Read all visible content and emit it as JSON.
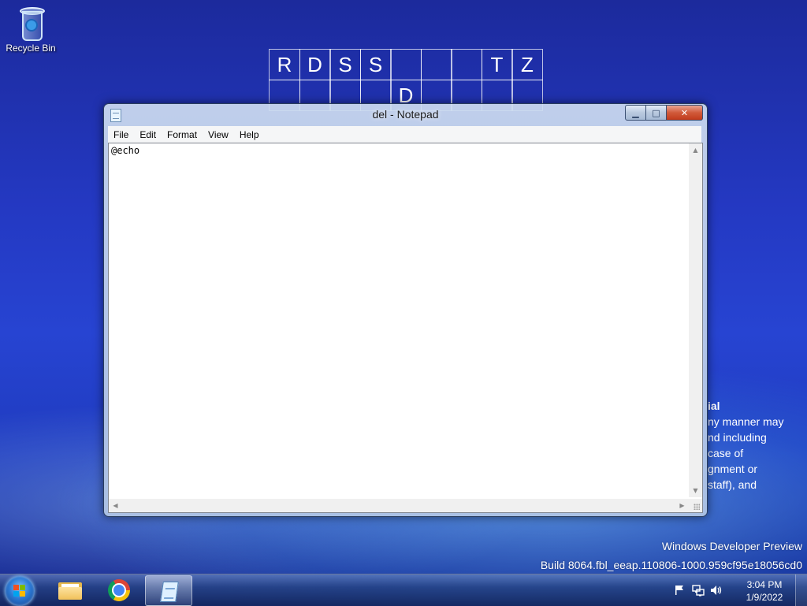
{
  "desktop": {
    "icons": [
      {
        "label": "Recycle Bin",
        "icon": "recycle-bin-icon"
      }
    ],
    "wallpaper_grid": [
      {
        "text": "R",
        "row": 0,
        "col": 0
      },
      {
        "text": "D",
        "row": 0,
        "col": 1
      },
      {
        "text": "S",
        "row": 0,
        "col": 2
      },
      {
        "text": "S",
        "row": 0,
        "col": 3
      },
      {
        "text": "",
        "row": 0,
        "col": 4
      },
      {
        "text": "",
        "row": 0,
        "col": 5
      },
      {
        "text": "",
        "row": 0,
        "col": 6
      },
      {
        "text": "T",
        "row": 0,
        "col": 7
      },
      {
        "text": "Z",
        "row": 0,
        "col": 8
      },
      {
        "text": "",
        "row": 1,
        "col": 0
      },
      {
        "text": "",
        "row": 1,
        "col": 1
      },
      {
        "text": "",
        "row": 1,
        "col": 2
      },
      {
        "text": "",
        "row": 1,
        "col": 3
      },
      {
        "text": "D",
        "row": 1,
        "col": 4
      },
      {
        "text": "",
        "row": 1,
        "col": 5
      },
      {
        "text": "",
        "row": 1,
        "col": 6
      },
      {
        "text": "",
        "row": 1,
        "col": 7
      },
      {
        "text": "",
        "row": 1,
        "col": 8
      }
    ],
    "legal_text_fragments": [
      "ial",
      "ny manner may",
      "nd including",
      " case of",
      "gnment or",
      "staff), and"
    ],
    "watermark": {
      "line1": "Windows Developer Preview",
      "line2": "Build 8064.fbl_eeap.110806-1000.959cf95e18056cd0"
    }
  },
  "notepad": {
    "title": "del - Notepad",
    "menu": [
      "File",
      "Edit",
      "Format",
      "View",
      "Help"
    ],
    "content": "@echo",
    "caption_buttons": {
      "minimize": "minimize-icon",
      "maximize": "maximize-icon",
      "close": "close-icon"
    }
  },
  "taskbar": {
    "start": "windows-start-icon",
    "pinned": [
      {
        "name": "file-explorer",
        "icon": "folder-icon",
        "active": false
      },
      {
        "name": "chrome",
        "icon": "chrome-icon",
        "active": false
      },
      {
        "name": "notepad",
        "icon": "notepad-icon",
        "active": true
      }
    ],
    "tray": {
      "icons": [
        "action-center-flag-icon",
        "network-icon",
        "volume-icon"
      ],
      "time": "3:04 PM",
      "date": "1/9/2022"
    }
  }
}
